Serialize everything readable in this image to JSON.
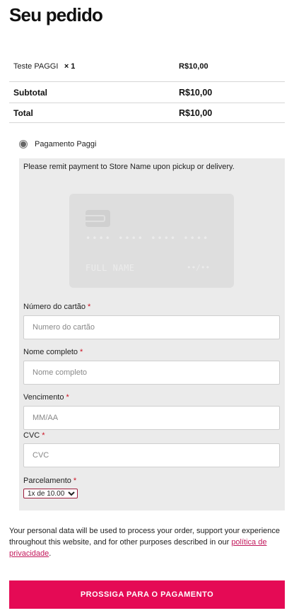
{
  "page": {
    "title": "Seu pedido"
  },
  "order": {
    "item_name": "Teste PAGGI",
    "item_qty": "× 1",
    "item_price": "R$10,00",
    "subtotal_label": "Subtotal",
    "subtotal_value": "R$10,00",
    "total_label": "Total",
    "total_value": "R$10,00"
  },
  "payment": {
    "method_label": "Pagamento Paggi",
    "description": "Please remit payment to Store Name upon pickup or delivery.",
    "card_preview": {
      "number": "•••• •••• •••• ••••",
      "name": "FULL NAME",
      "expiry": "••/••"
    },
    "fields": {
      "card_number_label": "Número do cartão",
      "card_number_placeholder": "Numero do cartão",
      "full_name_label": "Nome completo",
      "full_name_placeholder": "Nome completo",
      "expiry_label": "Vencimento",
      "expiry_placeholder": "MM/AA",
      "cvc_label": "CVC",
      "cvc_placeholder": "CVC",
      "installments_label": "Parcelamento",
      "installments_selected": "1x de 10.00",
      "required_mark": "*"
    }
  },
  "privacy": {
    "text": "Your personal data will be used to process your order, support your experience throughout this website, and for other purposes described in our ",
    "link_text": "política de privacidade",
    "suffix": "."
  },
  "submit": {
    "label": "PROSSIGA PARA O PAGAMENTO"
  },
  "colors": {
    "accent": "#e50a55",
    "link": "#c2185b",
    "required": "#cc1122",
    "panel": "#ebebeb"
  }
}
